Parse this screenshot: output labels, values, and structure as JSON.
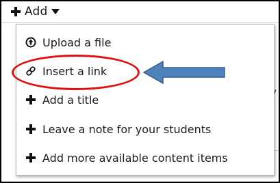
{
  "add_menu": {
    "toggle_label": "Add",
    "toggle_icon": "plus-icon",
    "caret_icon": "caret-down-icon",
    "items": [
      {
        "label": "Upload a file",
        "icon": "upload-circle-icon"
      },
      {
        "label": "Insert a link",
        "icon": "link-icon"
      },
      {
        "label": "Add a title",
        "icon": "plus-icon"
      },
      {
        "label": "Leave a note for your students",
        "icon": "plus-icon"
      },
      {
        "label": "Add more available content items",
        "icon": "plus-icon"
      }
    ]
  },
  "background": {
    "partial_glyph": "v"
  },
  "annotation": {
    "highlight_color": "#e01010",
    "arrow_color": "#4f81bd",
    "highlighted_item": "Insert a link"
  }
}
